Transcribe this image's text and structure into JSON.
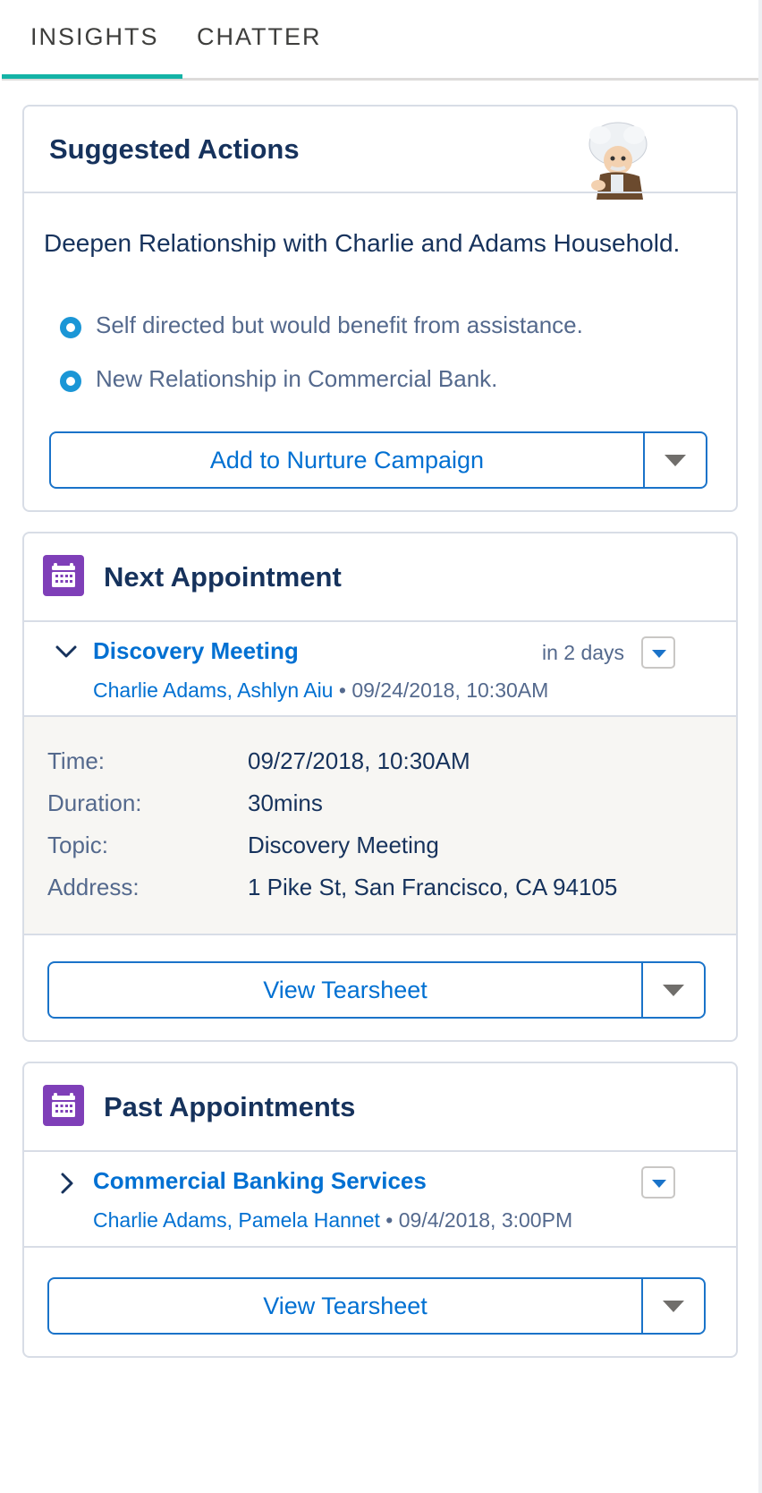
{
  "tabs": [
    {
      "label": "INSIGHTS",
      "active": true
    },
    {
      "label": "CHATTER",
      "active": false
    }
  ],
  "colors": {
    "accent_teal": "#14b3a6",
    "link_blue": "#0070d2",
    "heading_navy": "#16325c",
    "calendar_purple": "#7f3fb8"
  },
  "suggested": {
    "title": "Suggested Actions",
    "mascot_icon": "einstein-mascot-icon",
    "headline": "Deepen Relationship with Charlie and Adams Household.",
    "bullets": [
      "Self directed but would benefit from assistance.",
      "New Relationship in Commercial Bank."
    ],
    "button_label": "Add to Nurture Campaign"
  },
  "next": {
    "title": "Next Appointment",
    "icon": "calendar-icon",
    "meeting": {
      "title": "Discovery Meeting",
      "when": "in 2 days",
      "attendees": "Charlie Adams, Ashlyn Aiu",
      "separator": "•",
      "datetime": "09/24/2018, 10:30AM",
      "expanded": true
    },
    "details": [
      {
        "label": "Time:",
        "value": "09/27/2018, 10:30AM"
      },
      {
        "label": "Duration:",
        "value": "30mins"
      },
      {
        "label": "Topic:",
        "value": "Discovery Meeting"
      },
      {
        "label": "Address:",
        "value": "1 Pike St, San Francisco, CA 94105"
      }
    ],
    "button_label": "View Tearsheet"
  },
  "past": {
    "title": "Past Appointments",
    "icon": "calendar-icon",
    "meeting": {
      "title": "Commercial Banking Services",
      "attendees": "Charlie Adams, Pamela Hannet",
      "separator": "•",
      "datetime": "09/4/2018, 3:00PM",
      "expanded": false
    },
    "button_label": "View Tearsheet"
  }
}
